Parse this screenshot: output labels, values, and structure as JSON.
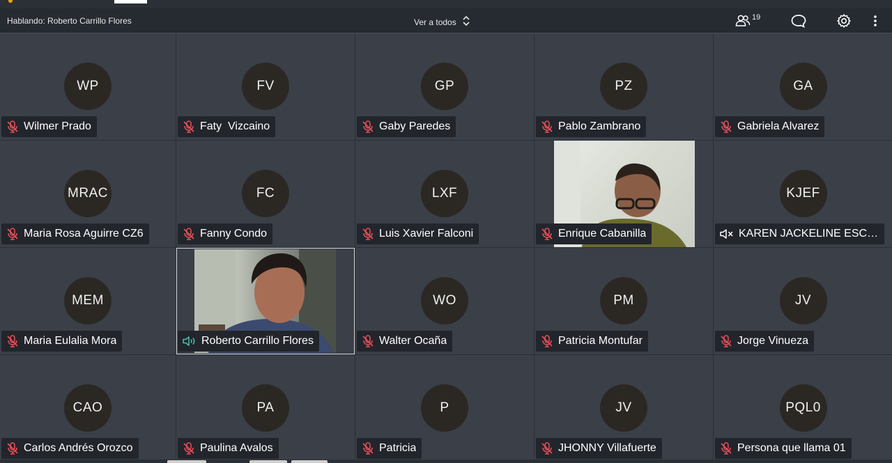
{
  "header": {
    "speaking": "Hablando: Roberto Carrillo Flores",
    "view_all": "Ver a todos",
    "participant_count": "19",
    "icons": [
      "participants-icon",
      "chat-icon",
      "settings-icon",
      "more-vert-icon"
    ]
  },
  "tiles": [
    {
      "initials": "WP",
      "name": "Wilmer Prado",
      "audio": "muted"
    },
    {
      "initials": "FV",
      "name": "Faty  Vizcaino",
      "audio": "muted"
    },
    {
      "initials": "GP",
      "name": "Gaby Paredes",
      "audio": "muted"
    },
    {
      "initials": "PZ",
      "name": "Pablo Zambrano",
      "audio": "muted"
    },
    {
      "initials": "GA",
      "name": "Gabriela Alvarez",
      "audio": "muted"
    },
    {
      "initials": "MRAC",
      "name": "Maria Rosa Aguirre CZ6",
      "audio": "muted"
    },
    {
      "initials": "FC",
      "name": "Fanny Condo",
      "audio": "muted"
    },
    {
      "initials": "LXF",
      "name": "Luis Xavier Falconi",
      "audio": "muted"
    },
    {
      "initials": "",
      "name": "Enrique Cabanilla",
      "audio": "muted",
      "video": true
    },
    {
      "initials": "KJEF",
      "name": "KAREN JACKELINE ESCOBAR",
      "audio": "speaker-off"
    },
    {
      "initials": "MEM",
      "name": "Maria Eulalia Mora",
      "audio": "muted"
    },
    {
      "initials": "",
      "name": "Roberto Carrillo Flores",
      "audio": "speaking",
      "video": true
    },
    {
      "initials": "WO",
      "name": "Walter Ocaña",
      "audio": "muted"
    },
    {
      "initials": "PM",
      "name": "Patricia Montufar",
      "audio": "muted"
    },
    {
      "initials": "JV",
      "name": "Jorge Vinueza",
      "audio": "muted"
    },
    {
      "initials": "CAO",
      "name": "Carlos Andrés Orozco",
      "audio": "muted"
    },
    {
      "initials": "PA",
      "name": "Paulina Avalos",
      "audio": "muted"
    },
    {
      "initials": "P",
      "name": "Patricia",
      "audio": "muted"
    },
    {
      "initials": "JV",
      "name": "JHONNY Villafuerte",
      "audio": "muted"
    },
    {
      "initials": "PQL0",
      "name": "Persona que llama 01",
      "audio": "muted"
    }
  ],
  "colors": {
    "muted_icon": "#e8505b",
    "speaking_icon": "#3ec7b0",
    "tile_bg": "#3a3f48",
    "avatar_bg": "#2b2824"
  }
}
